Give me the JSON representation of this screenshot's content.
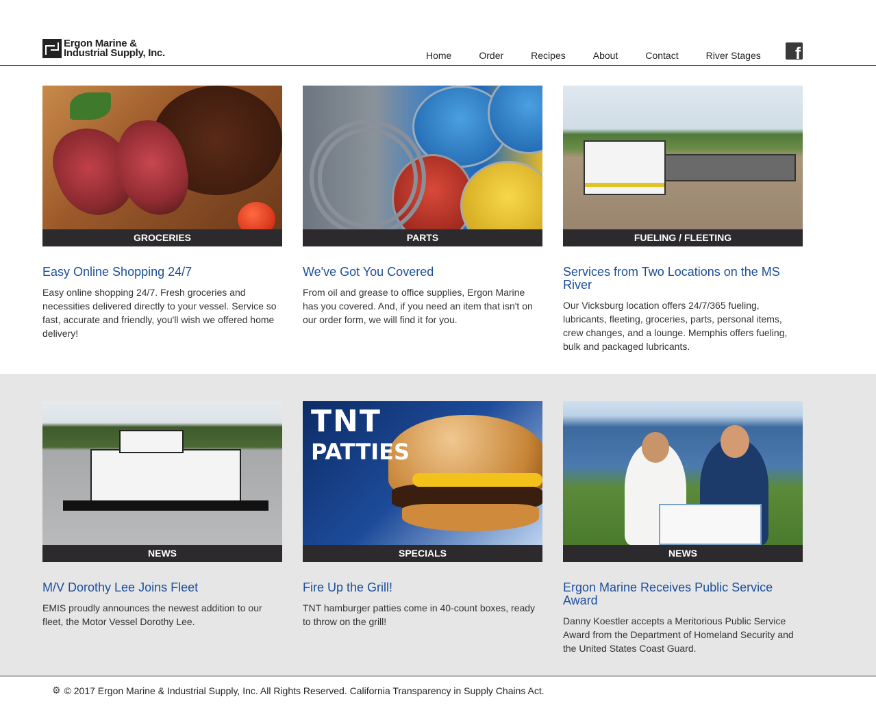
{
  "header": {
    "logo_line1": "Ergon Marine &",
    "logo_line2": "Industrial Supply, Inc.",
    "nav": [
      "Home",
      "Order",
      "Recipes",
      "About",
      "Contact",
      "River Stages"
    ],
    "facebook_icon": "facebook-icon"
  },
  "cards_top": [
    {
      "label": "GROCERIES",
      "title": "Easy Online Shopping 24/7",
      "text": "Easy online shopping 24/7. Fresh groceries and necessities delivered directly to your vessel. Service so fast, accurate and friendly, you'll wish we offered home delivery!"
    },
    {
      "label": "PARTS",
      "title": "We've Got You Covered",
      "text": "From oil and grease to office supplies, Ergon Marine has you covered. And, if you need an item that isn't on our order form, we will find it for you."
    },
    {
      "label": "FUELING / FLEETING",
      "title": "Services from Two Locations on the MS River",
      "text": "Our Vicksburg location offers 24/7/365 fueling, lubricants, fleeting, groceries, parts, personal items, crew changes, and a lounge. Memphis offers fueling, bulk and packaged lubricants."
    }
  ],
  "cards_bottom": [
    {
      "label": "NEWS",
      "title": "M/V Dorothy Lee Joins Fleet",
      "text": "EMIS proudly announces the newest addition to our fleet, the Motor Vessel Dorothy Lee."
    },
    {
      "label": "SPECIALS",
      "title": "Fire Up the Grill!",
      "text": "TNT hamburger patties come in 40-count boxes, ready to throw on the grill!",
      "image_text_1": "TNT",
      "image_text_2": "PATTIES"
    },
    {
      "label": "NEWS",
      "title": "Ergon Marine Receives Public Service Award",
      "text": "Danny Koestler accepts a Meritorious Public Service Award from the Department of Homeland Security and the United States Coast Guard."
    }
  ],
  "footer": {
    "icon": "gear-icon",
    "text": "© 2017 Ergon Marine & Industrial Supply, Inc. All Rights Reserved. California Transparency in Supply Chains Act."
  }
}
